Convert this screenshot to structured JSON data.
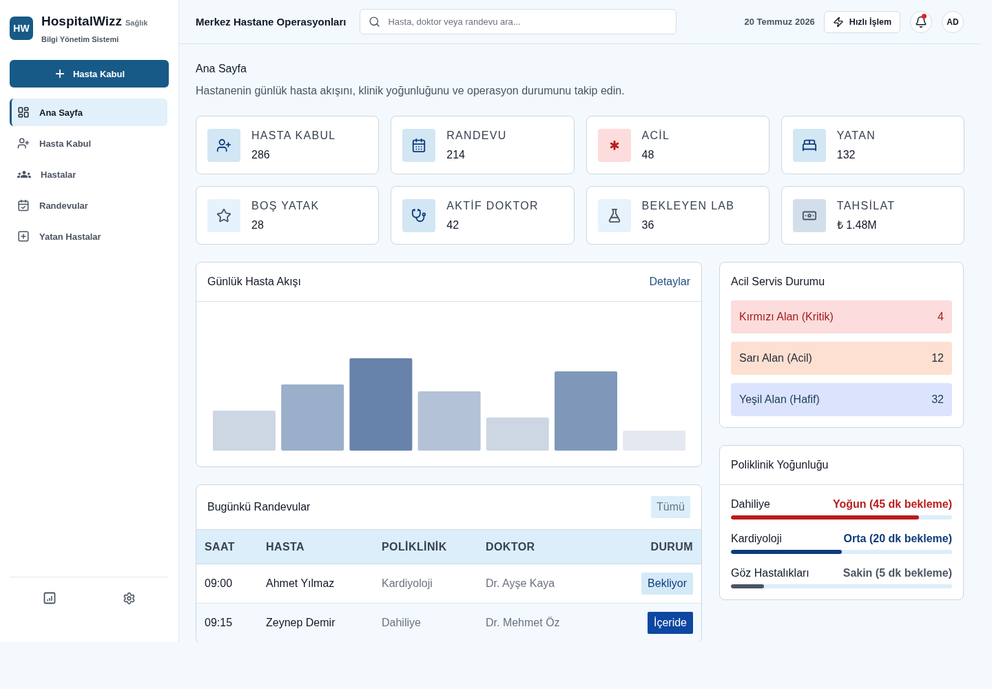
{
  "sidebar": {
    "logo": {
      "initials": "HW",
      "name": "HospitalWizz",
      "tag": "Sağlık",
      "subtitle": "Bilgi Yönetim Sistemi"
    },
    "primary_action": "Hasta Kabul",
    "nav": [
      {
        "label": "Ana Sayfa",
        "selected": true
      },
      {
        "label": "Hasta Kabul",
        "selected": false
      },
      {
        "label": "Hastalar",
        "selected": false
      },
      {
        "label": "Randevular",
        "selected": false
      },
      {
        "label": "Yatan Hastalar",
        "selected": false
      }
    ]
  },
  "header": {
    "title": "Merkez Hastane Operasyonları",
    "search": {
      "placeholder": "Hasta, doktor veya randevu ara..."
    },
    "date": "20 Temmuz 2026",
    "quick_action": "Hızlı İşlem",
    "notifications": {
      "unread": true
    },
    "avatar": "AD"
  },
  "page": {
    "title": "Ana Sayfa",
    "description": "Hastanenin günlük hasta akışını, klinik yoğunluğunu ve operasyon durumunu takip edin."
  },
  "stats": [
    {
      "label": "HASTA KABUL",
      "value": "286",
      "kind": "info"
    },
    {
      "label": "RANDEVU",
      "value": "214",
      "kind": "info"
    },
    {
      "label": "ACİL",
      "value": "48",
      "kind": "danger"
    },
    {
      "label": "YATAN",
      "value": "132",
      "kind": "info"
    },
    {
      "label": "BOŞ YATAK",
      "value": "28",
      "kind": "light"
    },
    {
      "label": "AKTİF DOKTOR",
      "value": "42",
      "kind": "info"
    },
    {
      "label": "BEKLEYEN LAB",
      "value": "36",
      "kind": "light"
    },
    {
      "label": "TAHSİLAT",
      "value": "₺ 1.48M",
      "kind": "slate"
    }
  ],
  "patient_flow": {
    "title": "Günlük Hasta Akışı",
    "link": "Detaylar"
  },
  "appointments": {
    "title": "Bugünkü Randevular",
    "button": "Tümü",
    "columns": [
      "SAAT",
      "HASTA",
      "POLİKLİNİK",
      "DOKTOR",
      "DURUM"
    ],
    "rows": [
      {
        "time": "09:00",
        "patient": "Ahmet Yılmaz",
        "clinic": "Kardiyoloji",
        "doctor": "Dr. Ayşe Kaya",
        "status": "Bekliyor",
        "kind": "waiting"
      },
      {
        "time": "09:15",
        "patient": "Zeynep Demir",
        "clinic": "Dahiliye",
        "doctor": "Dr. Mehmet Öz",
        "status": "İçeride",
        "kind": "inside"
      }
    ]
  },
  "emergency": {
    "title": "Acil Servis Durumu",
    "zones": [
      {
        "label": "Kırmızı Alan (Kritik)",
        "count": "4",
        "kind": "critical"
      },
      {
        "label": "Sarı Alan (Acil)",
        "count": "12",
        "kind": "urgent"
      },
      {
        "label": "Yeşil Alan (Hafif)",
        "count": "32",
        "kind": "mild"
      }
    ]
  },
  "clinic_load": {
    "title": "Poliklinik Yoğunluğu",
    "items": [
      {
        "name": "Dahiliye",
        "status": "Yoğun (45 dk bekleme)",
        "level": 0.85,
        "kind": "high"
      },
      {
        "name": "Kardiyoloji",
        "status": "Orta (20 dk bekleme)",
        "level": 0.5,
        "kind": "medium"
      },
      {
        "name": "Göz Hastalıkları",
        "status": "Sakin (5 dk bekleme)",
        "level": 0.15,
        "kind": "low"
      }
    ]
  }
}
